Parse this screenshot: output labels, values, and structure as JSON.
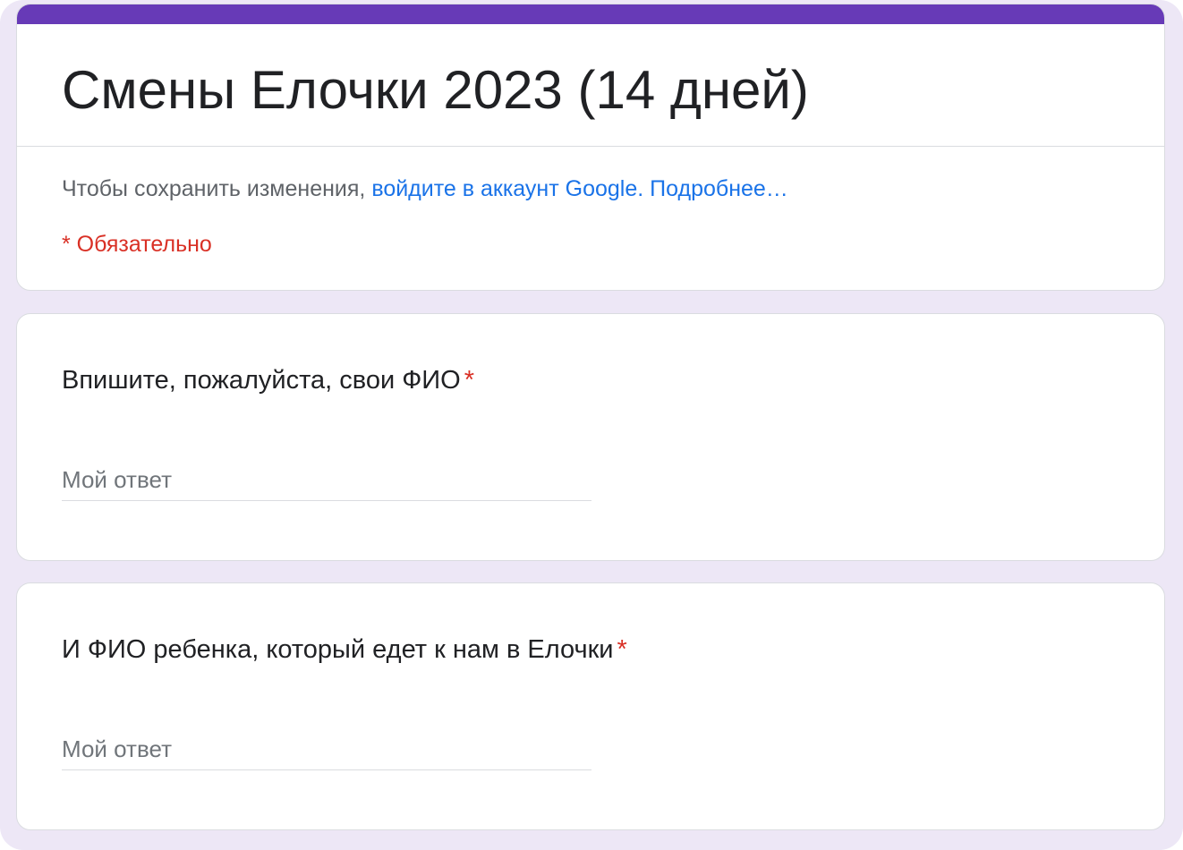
{
  "form": {
    "title": "Смены Елочки 2023 (14 дней)",
    "signin_prefix": "Чтобы сохранить изменения,",
    "signin_link": "войдите в аккаунт Google.",
    "learn_more_link": "Подробнее…",
    "required_note": "* Обязательно"
  },
  "questions": [
    {
      "title": "Впишите, пожалуйста, свои ФИО",
      "required_mark": "*",
      "placeholder": "Мой ответ",
      "value": ""
    },
    {
      "title": "И ФИО ребенка, который едет к нам в Елочки",
      "required_mark": "*",
      "placeholder": "Мой ответ",
      "value": ""
    }
  ],
  "colors": {
    "accent": "#673ab7",
    "background": "#ede7f6",
    "link": "#1a73e8",
    "required": "#d93025"
  }
}
